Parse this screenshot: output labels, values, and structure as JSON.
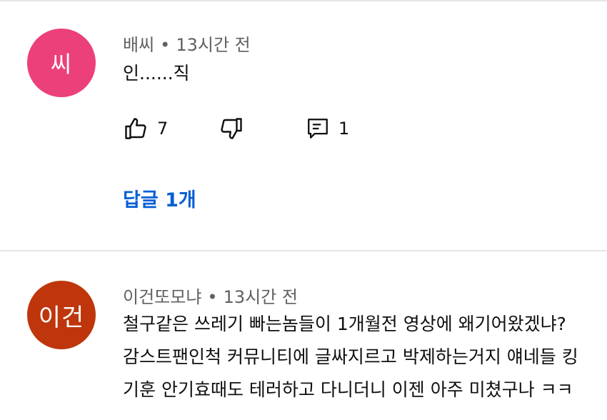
{
  "comments": [
    {
      "avatar_text": "씨",
      "avatar_color": "#ec407a",
      "author": "배씨",
      "separator": "•",
      "time": "13시간 전",
      "text": "인......직",
      "likes": "7",
      "reply_count": "1",
      "replies_link": "답글 1개"
    },
    {
      "avatar_text": "이건",
      "avatar_color": "#bf360c",
      "author": "이건또모냐",
      "separator": "•",
      "time": "13시간 전",
      "lines": [
        "철구같은 쓰레기 빠는놈들이 1개월전 영상에 왜기어왔겠냐?",
        "감스트팬인척 커뮤니티에 글싸지르고 박제하는거지 얘네들 킹",
        "기훈 안기효때도 테러하고 다니더니 이젠 아주 미쳤구나 ㅋㅋ"
      ]
    }
  ],
  "icons": {
    "like": "thumb-up-icon",
    "dislike": "thumb-down-icon",
    "reply": "comment-reply-icon"
  },
  "colors": {
    "link": "#065fd4",
    "meta": "#606060",
    "divider": "#e5e5e5"
  }
}
